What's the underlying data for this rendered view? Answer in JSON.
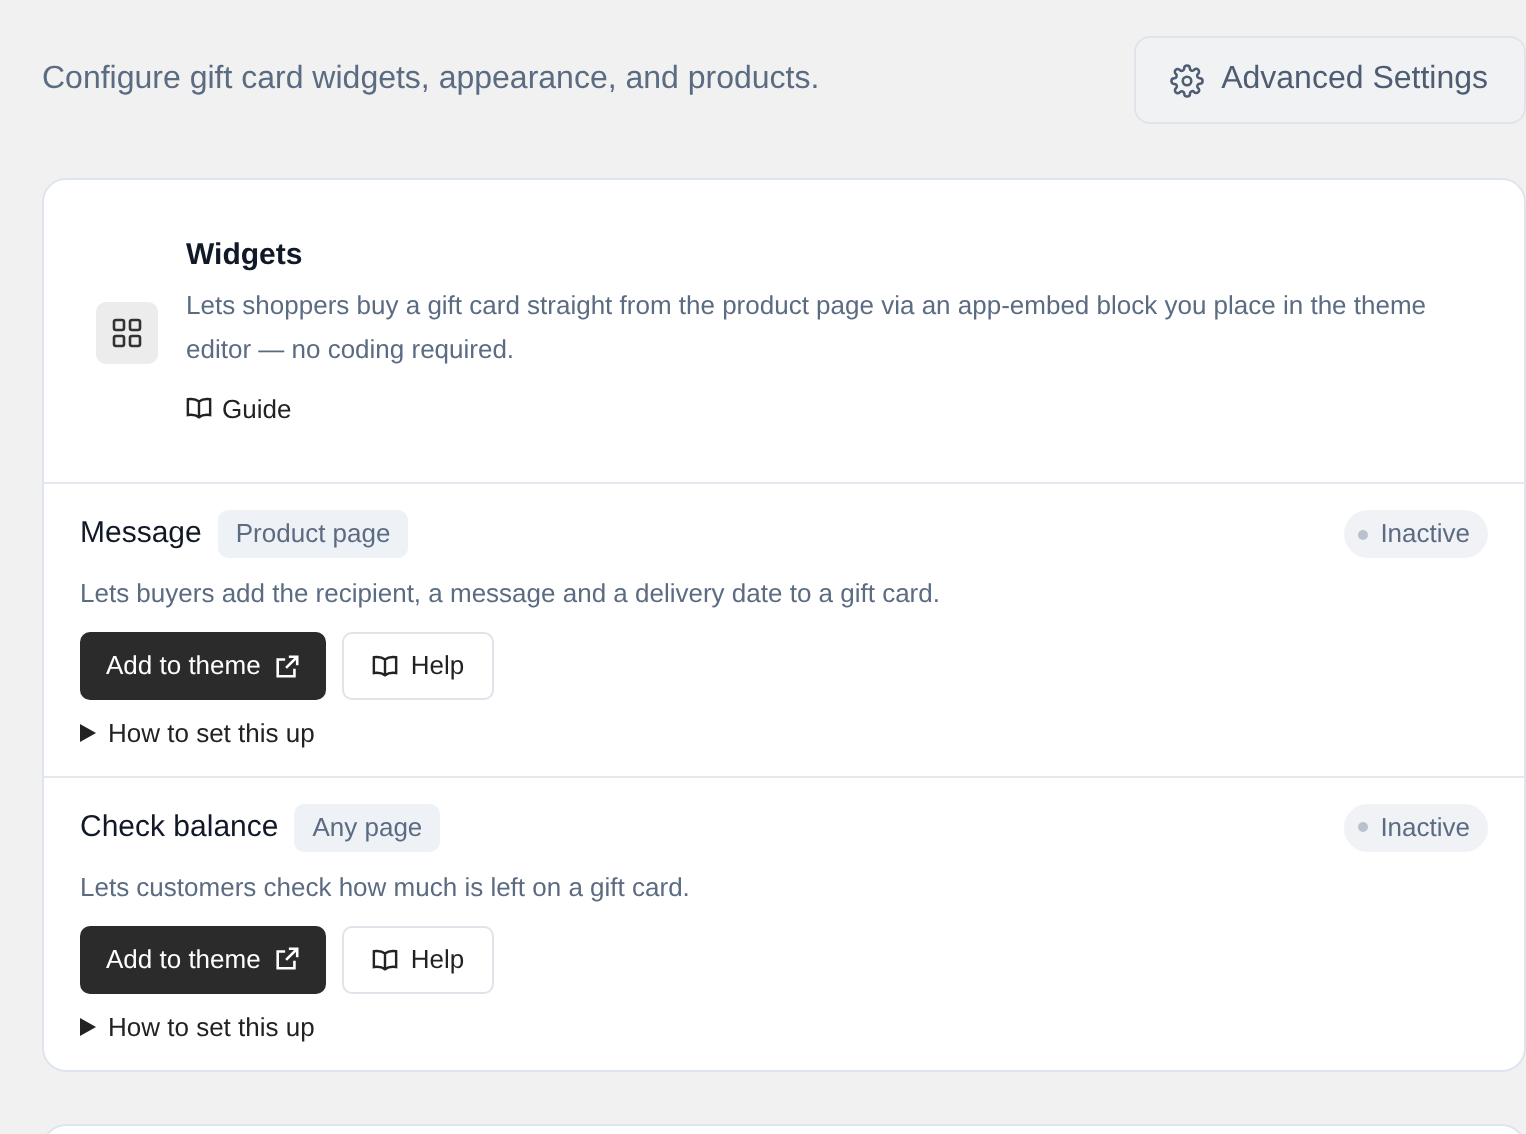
{
  "header": {
    "description": "Configure gift card widgets, appearance, and products.",
    "settings_button": "Advanced Settings"
  },
  "widgets_card": {
    "title": "Widgets",
    "description": "Lets shoppers buy a gift card straight from the product page via an app-embed block you place in the theme editor — no coding required.",
    "guide_link": "Guide",
    "items": [
      {
        "name": "Message",
        "scope": "Product page",
        "status": "Inactive",
        "active": false,
        "description": "Lets buyers add the recipient, a message and a delivery date to a gift card.",
        "primary_button": "Add to theme",
        "help_button": "Help",
        "setup_toggle": "How to set this up",
        "expanded": false
      },
      {
        "name": "Check balance",
        "scope": "Any page",
        "status": "Inactive",
        "active": false,
        "description": "Lets customers check how much is left on a gift card.",
        "primary_button": "Add to theme",
        "help_button": "Help",
        "setup_toggle": "How to set this up",
        "expanded": false
      }
    ]
  }
}
